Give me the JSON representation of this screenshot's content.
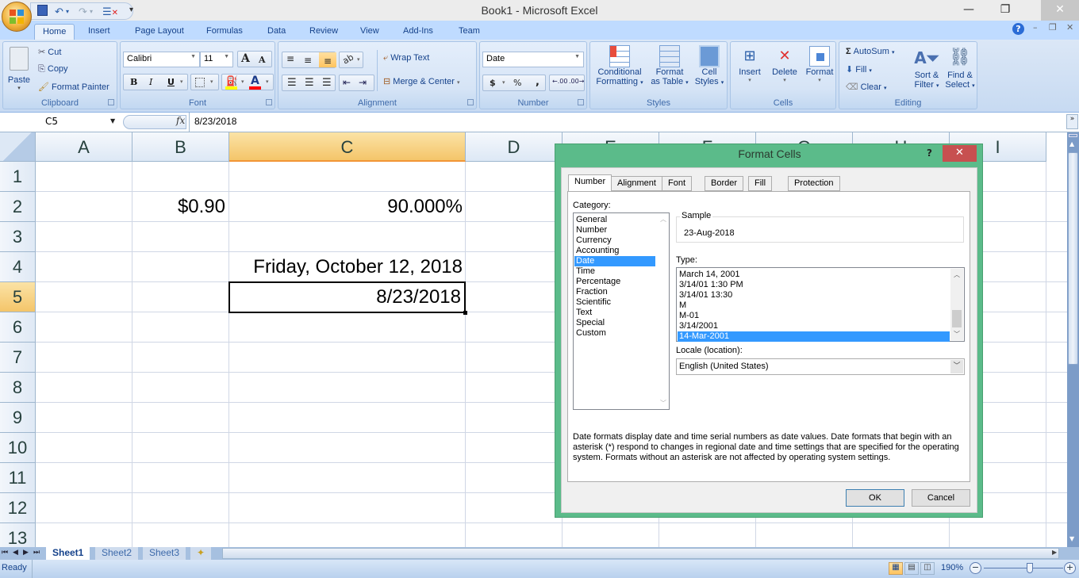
{
  "window": {
    "title": "Book1 - Microsoft Excel",
    "minimize": "—",
    "restore": "❐",
    "close": "✕"
  },
  "quick_access": {
    "save_icon": "save-icon",
    "undo_icon": "undo-icon",
    "redo_icon": "redo-icon",
    "customize_icon": "customize-icon"
  },
  "tabs": [
    {
      "label": "Home",
      "active": true
    },
    {
      "label": "Insert"
    },
    {
      "label": "Page Layout"
    },
    {
      "label": "Formulas"
    },
    {
      "label": "Data"
    },
    {
      "label": "Review"
    },
    {
      "label": "View"
    },
    {
      "label": "Add-Ins"
    },
    {
      "label": "Team"
    }
  ],
  "ribbon": {
    "clipboard": {
      "label": "Clipboard",
      "paste": "Paste",
      "cut": "Cut",
      "copy": "Copy",
      "format_painter": "Format Painter"
    },
    "font": {
      "label": "Font",
      "font_name": "Calibri",
      "font_size": "11",
      "grow": "A",
      "shrink": "A",
      "bold": "B",
      "italic": "I",
      "underline": "U",
      "fill_color": "#ffff00",
      "font_color": "#ff0000"
    },
    "alignment": {
      "label": "Alignment",
      "wrap_text": "Wrap Text",
      "merge_center": "Merge & Center"
    },
    "number": {
      "label": "Number",
      "format": "Date",
      "currency": "$",
      "percent": "%",
      "comma": ","
    },
    "styles": {
      "label": "Styles",
      "conditional_1": "Conditional",
      "conditional_2": "Formatting",
      "format_table_1": "Format",
      "format_table_2": "as Table",
      "cell_styles_1": "Cell",
      "cell_styles_2": "Styles"
    },
    "cells": {
      "label": "Cells",
      "insert": "Insert",
      "delete": "Delete",
      "format": "Format"
    },
    "editing": {
      "label": "Editing",
      "autosum": "AutoSum",
      "fill": "Fill",
      "clear": "Clear",
      "sort_1": "Sort &",
      "sort_2": "Filter",
      "find_1": "Find &",
      "find_2": "Select"
    }
  },
  "formula_bar": {
    "name_box": "C5",
    "fx": "fx",
    "value": "8/23/2018"
  },
  "grid": {
    "columns": [
      "A",
      "B",
      "C",
      "D",
      "E",
      "F",
      "G",
      "H",
      "I"
    ],
    "selected_column": "C",
    "rows": [
      "1",
      "2",
      "3",
      "4",
      "5",
      "6",
      "7",
      "8",
      "9",
      "10",
      "11",
      "12",
      "13"
    ],
    "selected_row": "5",
    "cells": {
      "B2": "$0.90",
      "C2": "90.000%",
      "C4": "Friday, October 12, 2018",
      "C5": "8/23/2018"
    }
  },
  "sheets": [
    {
      "label": "Sheet1",
      "active": true
    },
    {
      "label": "Sheet2"
    },
    {
      "label": "Sheet3"
    }
  ],
  "status": {
    "text": "Ready",
    "zoom": "190%",
    "zoom_fraction": 0.58
  },
  "dialog": {
    "title": "Format Cells",
    "help": "?",
    "close": "✕",
    "tabs": [
      "Number",
      "Alignment",
      "Font",
      "Border",
      "Fill",
      "Protection"
    ],
    "active_tab": "Number",
    "category_label": "Category:",
    "categories": [
      "General",
      "Number",
      "Currency",
      "Accounting",
      "Date",
      "Time",
      "Percentage",
      "Fraction",
      "Scientific",
      "Text",
      "Special",
      "Custom"
    ],
    "selected_category": "Date",
    "sample_label": "Sample",
    "sample_value": "23-Aug-2018",
    "type_label": "Type:",
    "types": [
      "March 14, 2001",
      "3/14/01 1:30 PM",
      "3/14/01 13:30",
      "M",
      "M-01",
      "3/14/2001",
      "14-Mar-2001"
    ],
    "selected_type": "14-Mar-2001",
    "locale_label": "Locale (location):",
    "locale_value": "English (United States)",
    "description": "Date formats display date and time serial numbers as date values.  Date formats that begin with an asterisk (*) respond to changes in regional date and time settings that are specified for the operating system. Formats without an asterisk are not affected by operating system settings.",
    "ok": "OK",
    "cancel": "Cancel"
  }
}
